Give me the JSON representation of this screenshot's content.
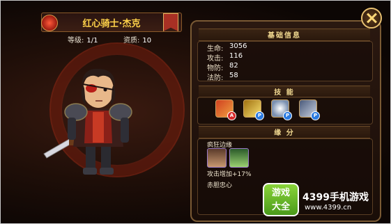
{
  "header": {
    "title": "红心骑士·杰克",
    "level_label": "等级:",
    "level_value": "1/1",
    "quality_label": "资质:",
    "quality_value": "10"
  },
  "basic_info": {
    "title": "基础信息",
    "attributes": [
      {
        "label": "生命:",
        "value": "3056"
      },
      {
        "label": "攻击:",
        "value": "116"
      },
      {
        "label": "物防:",
        "value": "82"
      },
      {
        "label": "法防:",
        "value": "58"
      }
    ]
  },
  "skills": {
    "title": "技 能",
    "items": [
      {
        "icon": "sword-slash-skill-icon",
        "badge": "A",
        "badge_color": "#d82a2a"
      },
      {
        "icon": "golden-spikes-skill-icon",
        "badge": "P",
        "badge_color": "#2a7ae0"
      },
      {
        "icon": "silver-orb-skill-icon",
        "badge": "P",
        "badge_color": "#2a7ae0"
      },
      {
        "icon": "knight-helmet-skill-icon",
        "badge": "P",
        "badge_color": "#2a7ae0"
      }
    ]
  },
  "bonds": {
    "title": "缘 分",
    "entries": [
      {
        "name": "疯狂边缘",
        "effect": "攻击增加+17%"
      },
      {
        "name": "赤胆忠心"
      }
    ]
  },
  "watermark": {
    "logo_top": "游戏",
    "logo_bottom": "大全",
    "brand": "4399手机游戏",
    "url": "www.4399.cn"
  }
}
